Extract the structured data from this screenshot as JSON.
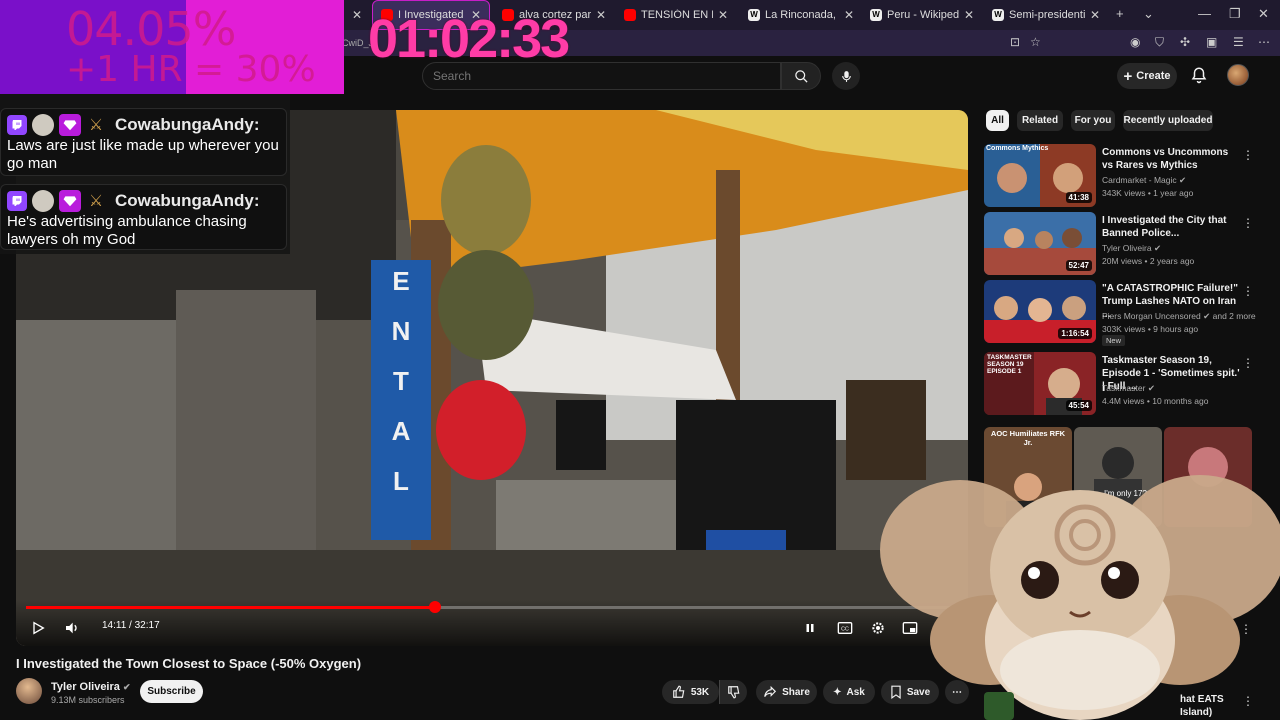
{
  "browser": {
    "tabs": [
      {
        "label": "",
        "icon": "close-icon"
      },
      {
        "label": "I Investigated the Town",
        "icon": "youtube-icon"
      },
      {
        "label": "alva cortez parliament -",
        "icon": "youtube-icon"
      },
      {
        "label": "TENSIÓN EN EL CON",
        "icon": "youtube-icon"
      },
      {
        "label": "La Rinconada, Peru - Wi",
        "icon": "wikipedia-icon"
      },
      {
        "label": "Peru - Wikipedia",
        "icon": "wikipedia-icon"
      },
      {
        "label": "Semi-presidential syster",
        "icon": "wikipedia-icon"
      }
    ],
    "address_fragment": "CwiD_J"
  },
  "overlay": {
    "percent_line1": "04.05%",
    "percent_line2": "+1 HR = 30%",
    "timer": "01:02:33",
    "chat": [
      {
        "user": "CowabungaAndy:",
        "text": "Laws are just like made up wherever you go man"
      },
      {
        "user": "CowabungaAndy:",
        "text": "He's advertising ambulance chasing lawyers oh my God"
      }
    ]
  },
  "header": {
    "search_placeholder": "Search",
    "create_label": "Create"
  },
  "video": {
    "current_time": "14:11",
    "duration": "32:17",
    "time_display": "14:11 / 32:17",
    "progress_fraction": 0.4393,
    "title": "I Investigated the Town Closest to Space (-50% Oxygen)",
    "scene_sign_letters": "ENTAL"
  },
  "channel": {
    "name": "Tyler Oliveira",
    "subscribers": "9.13M subscribers",
    "subscribe_label": "Subscribe"
  },
  "actions": {
    "likes": "53K",
    "share": "Share",
    "ask": "Ask",
    "save": "Save"
  },
  "chips": [
    "All",
    "Related",
    "For you",
    "Recently uploaded"
  ],
  "recommendations": [
    {
      "title": "Commons vs Uncommons vs Rares vs Mythics",
      "channel": "Cardmarket - Magic",
      "meta": "343K views • 1 year ago",
      "duration": "41:38",
      "thumb_text": "Commons  Mythics"
    },
    {
      "title": "I Investigated the City that Banned Police...",
      "channel": "Tyler Oliveira",
      "meta": "20M views • 2 years ago",
      "duration": "52:47",
      "thumb_text": ""
    },
    {
      "title": "\"A CATASTROPHIC Failure!\" Trump Lashes NATO on Iran ...",
      "channel": "Piers Morgan Uncensored",
      "channel_extra": "and 2 more",
      "meta": "303K views • 9 hours ago",
      "duration": "1:16:54",
      "tag": "New",
      "thumb_text": ""
    },
    {
      "title": "Taskmaster Season 19, Episode 1 - 'Sometimes spit.' | Full ...",
      "channel": "Taskmaster",
      "meta": "4.4M views • 10 months ago",
      "duration": "45:54",
      "thumb_text": "TASKMASTER SEASON 19 EPISODE 1"
    }
  ],
  "shorts": [
    {
      "caption": "AOC Humiliates RFK Jr."
    },
    {
      "caption": "I'm only 17?"
    },
    {
      "caption": ""
    }
  ],
  "bottom_rec": {
    "title_line1": "hat EATS",
    "title_line2": "Island)"
  }
}
